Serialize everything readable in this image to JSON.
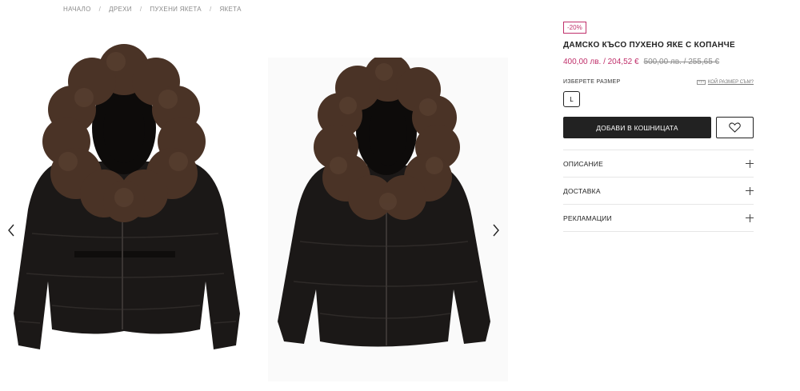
{
  "breadcrumb": {
    "items": [
      "НАЧАЛО",
      "ДРЕХИ",
      "ПУХЕНИ ЯКЕТА",
      "ЯКЕТА"
    ],
    "separator": "/"
  },
  "gallery": {
    "prev_icon": "chevron-left-icon",
    "next_icon": "chevron-right-icon",
    "colors": {
      "fur": "#4a3326",
      "jacket": "#1b1817"
    }
  },
  "product": {
    "discount_badge": "-20%",
    "title": "ДАМСКО КЪСО ПУХЕНО ЯКЕ С КОПАНЧЕ",
    "price_current": "400,00 лв. / 204,52 €",
    "price_old": "500,00 лв. / 255,65 €",
    "size_label": "ИЗБЕРЕТЕ РАЗМЕР",
    "size_chart_label": "КОЙ РАЗМЕР СЪМ?",
    "size_chart_icon": "ruler-icon",
    "sizes": [
      "L"
    ],
    "add_to_cart": "ДОБАВИ В КОШНИЦАТА",
    "wishlist_icon": "heart-icon",
    "accent_color": "#c0306b"
  },
  "accordion": {
    "items": [
      "ОПИСАНИЕ",
      "ДОСТАВКА",
      "РЕКЛАМАЦИИ"
    ]
  }
}
